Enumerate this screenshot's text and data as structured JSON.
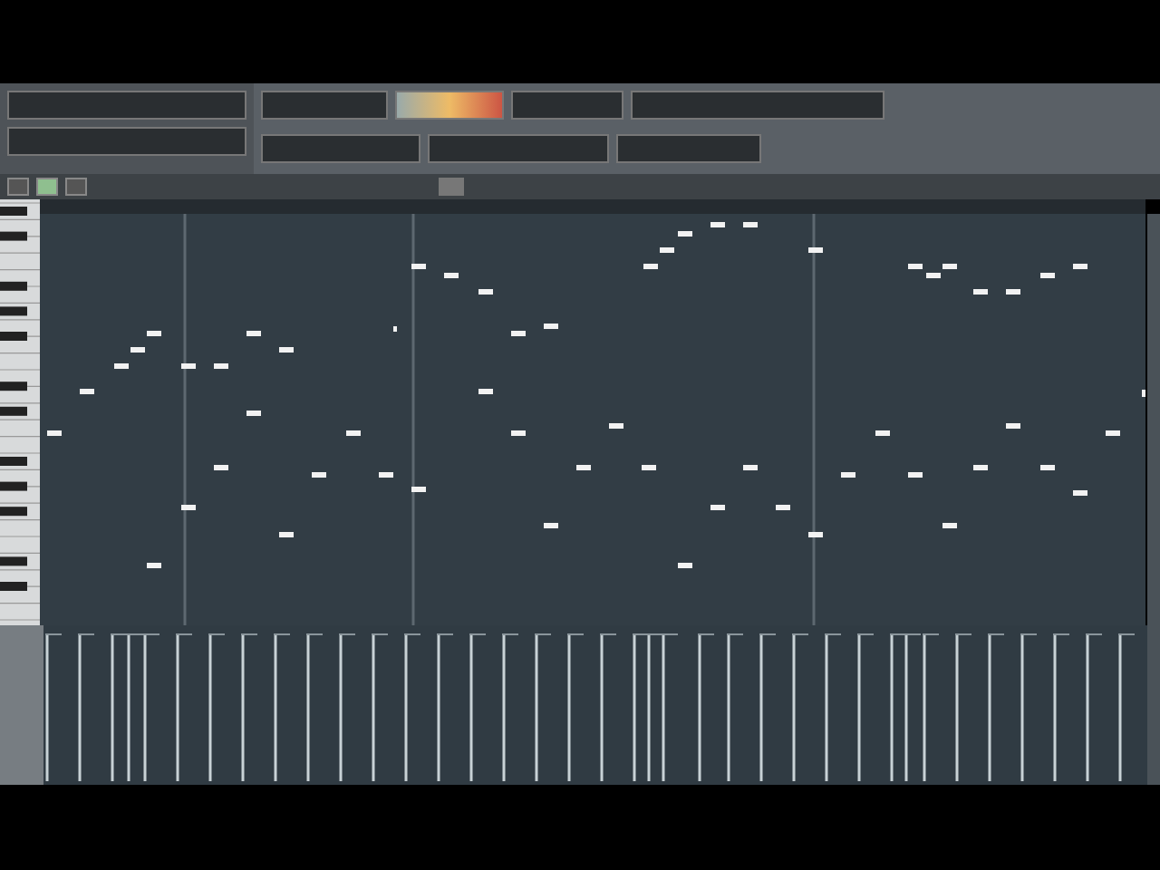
{
  "piano_roll": {
    "tools": [
      {
        "selected": false
      },
      {
        "selected": true
      },
      {
        "selected": false
      }
    ]
  }
}
